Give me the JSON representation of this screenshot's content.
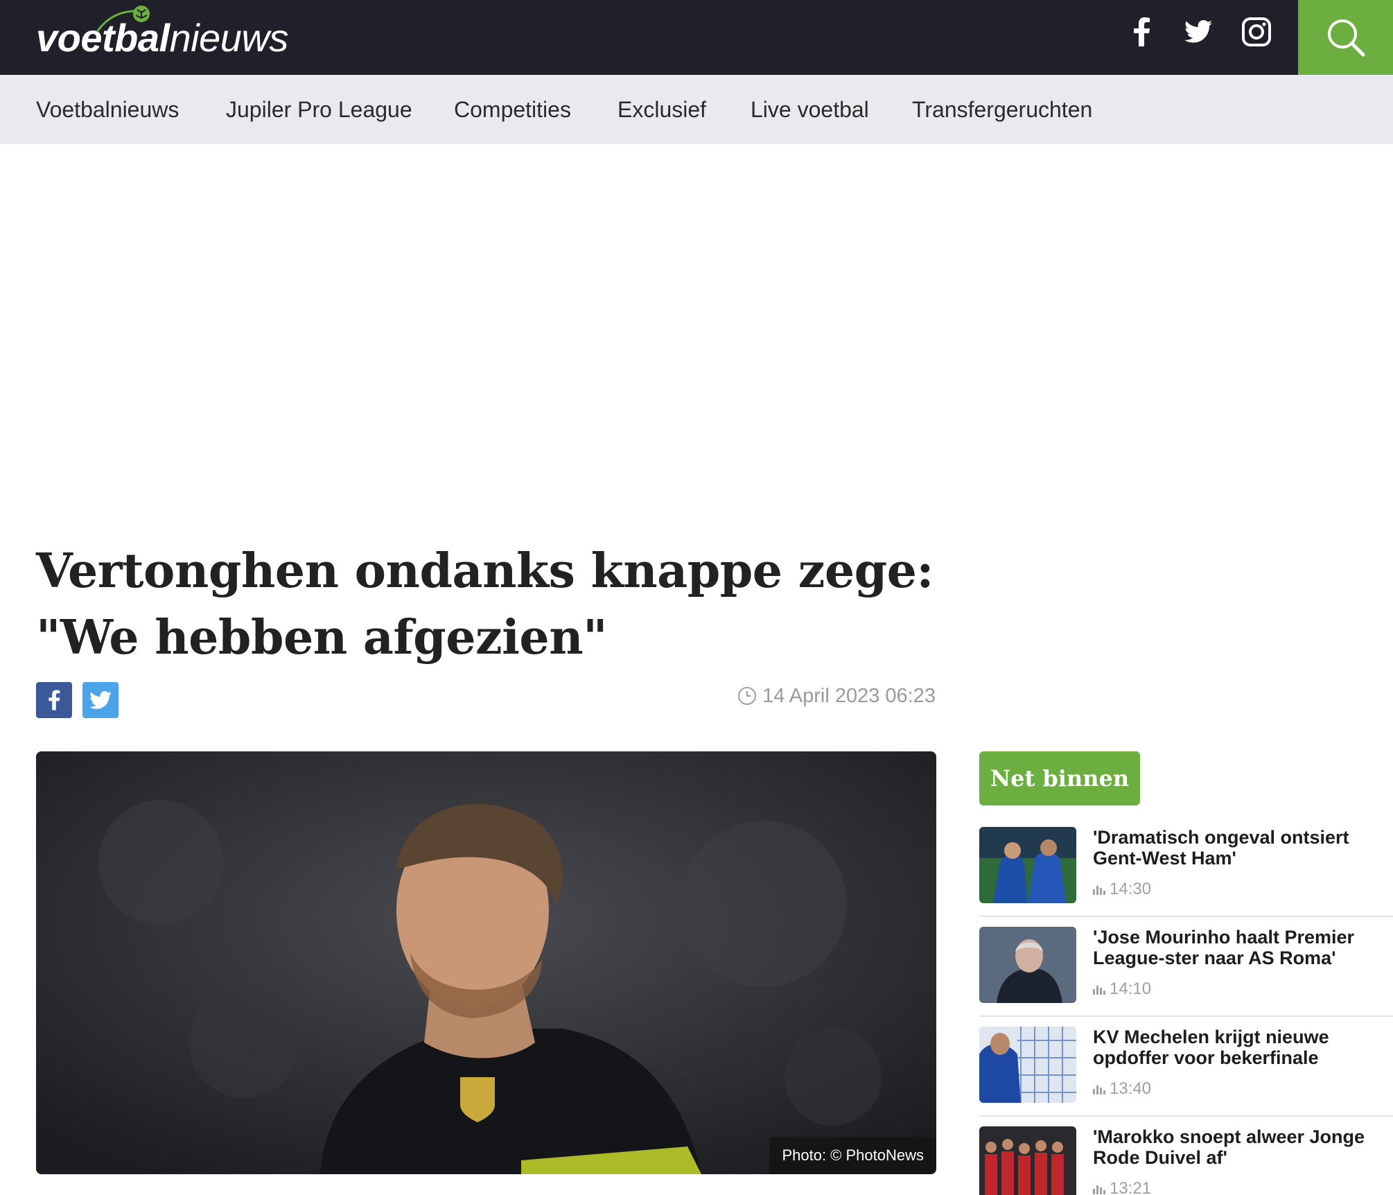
{
  "header": {
    "logo_bold": "voetbal",
    "logo_light": "nieuws",
    "social": [
      "facebook-icon",
      "twitter-icon",
      "instagram-icon"
    ],
    "search_icon": "search-icon",
    "accent": "#6cae3f",
    "background": "#1f2029"
  },
  "nav": {
    "items": [
      "Voetbalnieuws",
      "Jupiler Pro League",
      "Competities",
      "Exclusief",
      "Live voetbal",
      "Transfergeruchten"
    ]
  },
  "article": {
    "title_line1": "Vertonghen ondanks knappe zege:",
    "title_line2": "\"We hebben afgezien\"",
    "date": "14 April 2023 06:23",
    "photo_credit": "Photo: © PhotoNews",
    "share": [
      "facebook-icon",
      "twitter-icon"
    ]
  },
  "sidebar": {
    "badge": "Net binnen",
    "items": [
      {
        "title": "'Dramatisch ongeval ontsiert Gent-West Ham'",
        "time": "14:30"
      },
      {
        "title": "'Jose Mourinho haalt Premier League-ster naar AS Roma'",
        "time": "14:10"
      },
      {
        "title": "KV Mechelen krijgt nieuwe opdoffer voor bekerfinale",
        "time": "13:40"
      },
      {
        "title": "'Marokko snoept alweer Jonge Rode Duivel af'",
        "time": "13:21"
      }
    ]
  }
}
